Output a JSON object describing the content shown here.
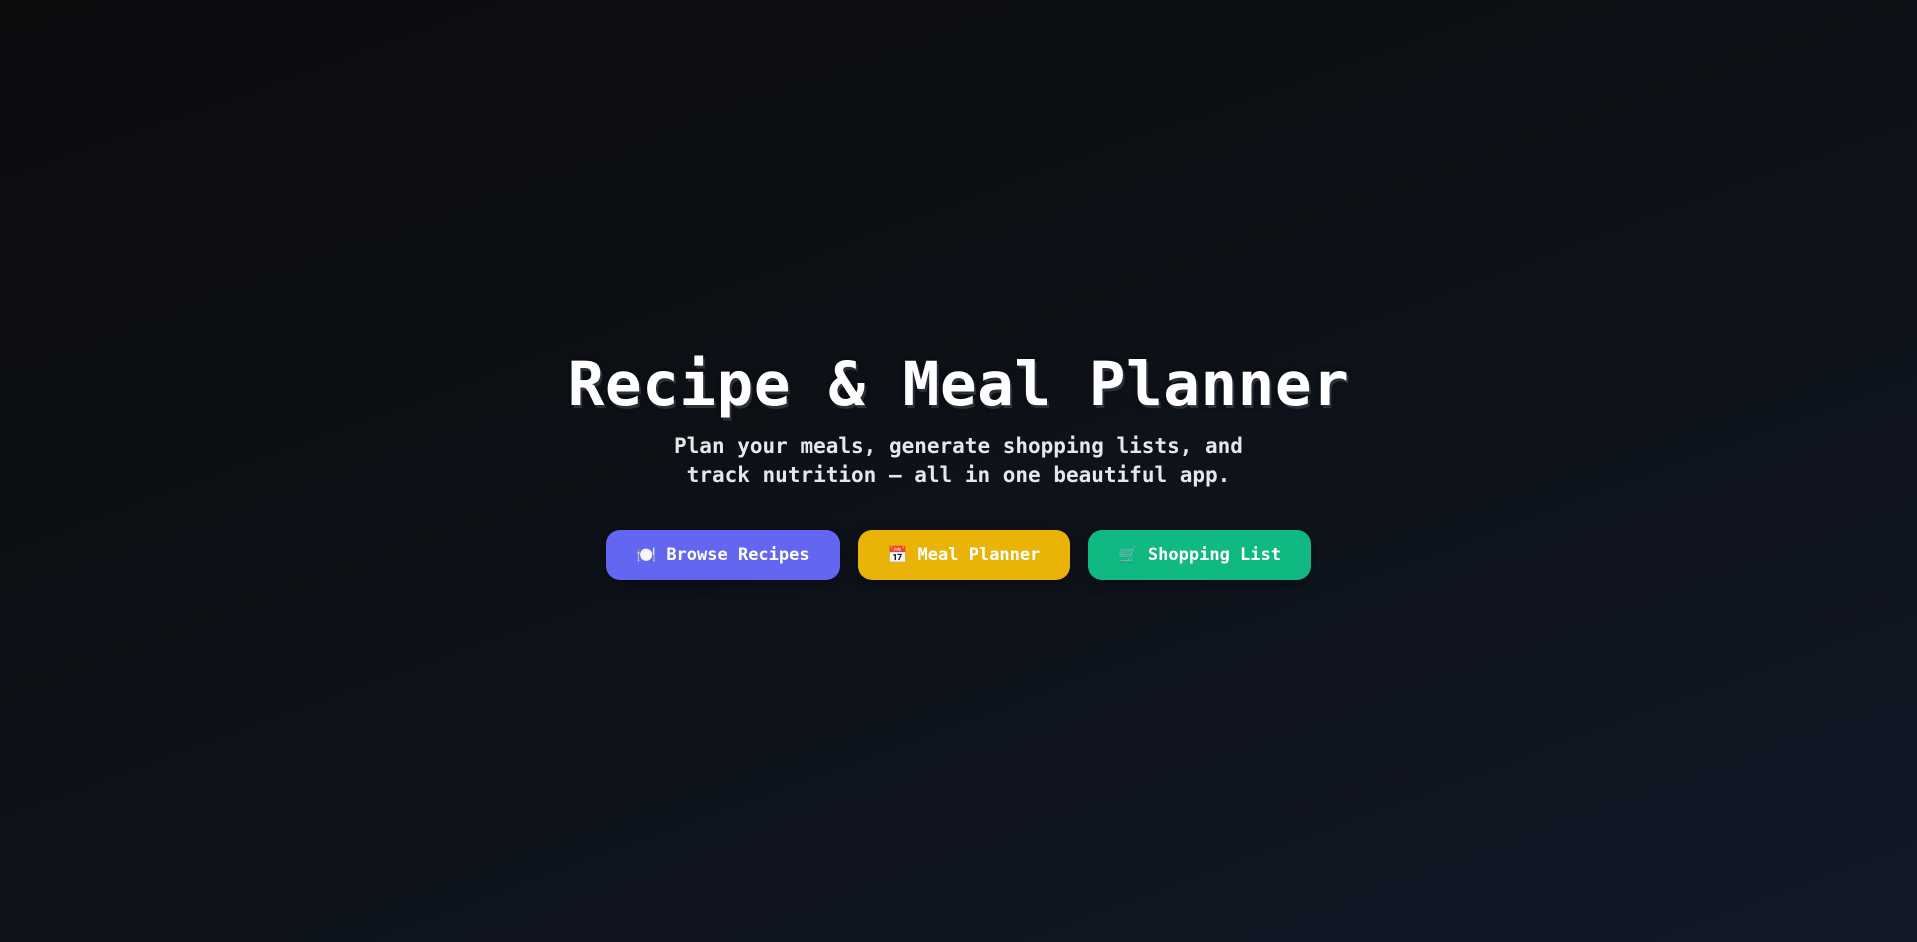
{
  "hero": {
    "title": "Recipe & Meal Planner",
    "subtitle": "Plan your meals, generate shopping lists, and track nutrition — all in one beautiful app."
  },
  "actions": [
    {
      "label": "Browse Recipes",
      "icon": "🍽️",
      "icon_name": "plate-icon",
      "color": "#6366f1"
    },
    {
      "label": "Meal Planner",
      "icon": "📅",
      "icon_name": "calendar-icon",
      "color": "#eab308"
    },
    {
      "label": "Shopping List",
      "icon": "🛒",
      "icon_name": "shopping-cart-icon",
      "color": "#10b981"
    }
  ],
  "colors": {
    "background_start": "#0b0c0e",
    "background_end": "#111827",
    "text": "#ffffff"
  }
}
